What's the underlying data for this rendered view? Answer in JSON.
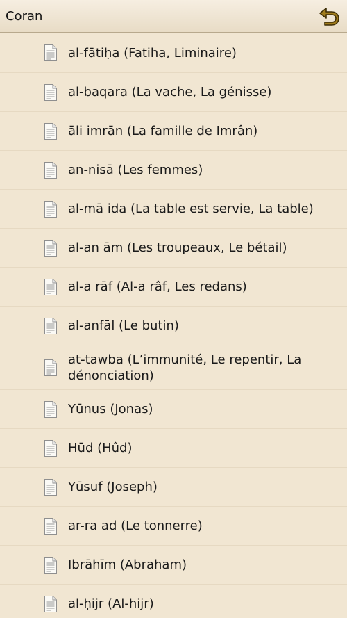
{
  "header": {
    "title": "Coran",
    "back_icon": "undo-arrow-icon"
  },
  "list": {
    "items": [
      {
        "label": "al-fātiḥa (Fatiha, Liminaire)"
      },
      {
        "label": "al-baqara (La vache, La génisse)"
      },
      {
        "label": "āli  imrān (La famille de  Imrân)"
      },
      {
        "label": "an-nisā  (Les femmes)"
      },
      {
        "label": "al-mā ida (La table est servie, La table)"
      },
      {
        "label": "al-an ām (Les troupeaux, Le bétail)"
      },
      {
        "label": "al-a rāf (Al-a râf, Les redans)"
      },
      {
        "label": "al-anfāl (Le butin)"
      },
      {
        "label": "at-tawba (L’immunité, Le repentir, La dénonciation)"
      },
      {
        "label": "Yūnus (Jonas)"
      },
      {
        "label": "Hūd (Hûd)"
      },
      {
        "label": "Yūsuf (Joseph)"
      },
      {
        "label": "ar-ra ad (Le tonnerre)"
      },
      {
        "label": "Ibrāhīm (Abraham)"
      },
      {
        "label": "al-ḥijr (Al-hijr)"
      }
    ],
    "item_icon": "document-icon"
  },
  "colors": {
    "background": "#f1e6d2",
    "accent": "#8a6a17",
    "divider": "#e6d9c2"
  }
}
